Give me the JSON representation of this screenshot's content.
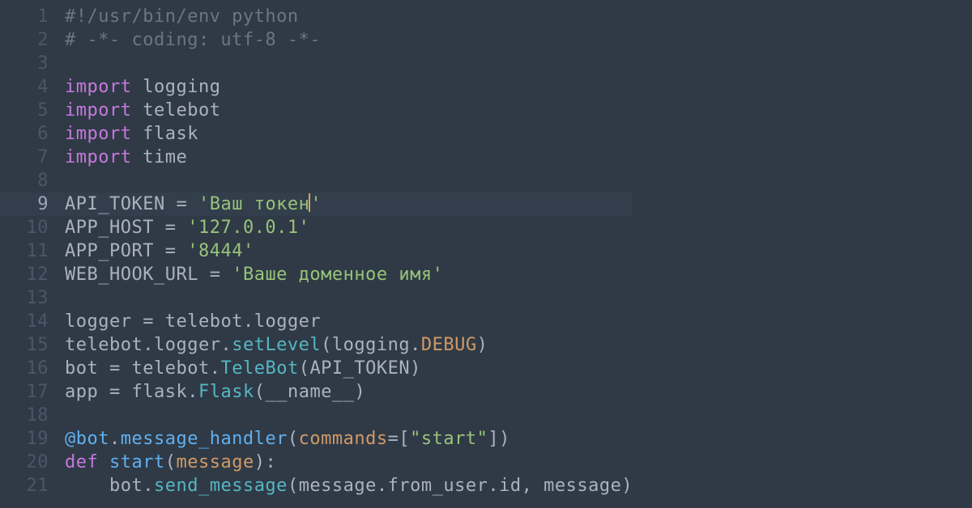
{
  "editor": {
    "language": "python",
    "cursor_line": 9,
    "gutter": [
      "1",
      "2",
      "3",
      "4",
      "5",
      "6",
      "7",
      "8",
      "9",
      "10",
      "11",
      "12",
      "13",
      "14",
      "15",
      "16",
      "17",
      "18",
      "19",
      "20",
      "21"
    ],
    "lines": [
      {
        "n": 1,
        "tokens": [
          [
            "c-comment",
            "#!/usr/bin/env python"
          ]
        ]
      },
      {
        "n": 2,
        "tokens": [
          [
            "c-comment",
            "# -*- coding: utf-8 -*-"
          ]
        ]
      },
      {
        "n": 3,
        "tokens": []
      },
      {
        "n": 4,
        "tokens": [
          [
            "c-kw",
            "import"
          ],
          [
            "space",
            " "
          ],
          [
            "c-mod",
            "logging"
          ]
        ]
      },
      {
        "n": 5,
        "tokens": [
          [
            "c-kw",
            "import"
          ],
          [
            "space",
            " "
          ],
          [
            "c-mod",
            "telebot"
          ]
        ]
      },
      {
        "n": 6,
        "tokens": [
          [
            "c-kw",
            "import"
          ],
          [
            "space",
            " "
          ],
          [
            "c-mod",
            "flask"
          ]
        ]
      },
      {
        "n": 7,
        "tokens": [
          [
            "c-kw",
            "import"
          ],
          [
            "space",
            " "
          ],
          [
            "c-mod",
            "time"
          ]
        ]
      },
      {
        "n": 8,
        "tokens": []
      },
      {
        "n": 9,
        "hl": true,
        "caret_after": 4,
        "tokens": [
          [
            "c-var",
            "API_TOKEN"
          ],
          [
            "space",
            " "
          ],
          [
            "c-op",
            "="
          ],
          [
            "space",
            " "
          ],
          [
            "c-str",
            "'Ваш токен'"
          ]
        ]
      },
      {
        "n": 10,
        "tokens": [
          [
            "c-var",
            "APP_HOST"
          ],
          [
            "space",
            " "
          ],
          [
            "c-op",
            "="
          ],
          [
            "space",
            " "
          ],
          [
            "c-str",
            "'127.0.0.1'"
          ]
        ]
      },
      {
        "n": 11,
        "tokens": [
          [
            "c-var",
            "APP_PORT"
          ],
          [
            "space",
            " "
          ],
          [
            "c-op",
            "="
          ],
          [
            "space",
            " "
          ],
          [
            "c-str",
            "'8444'"
          ]
        ]
      },
      {
        "n": 12,
        "tokens": [
          [
            "c-var",
            "WEB_HOOK_URL"
          ],
          [
            "space",
            " "
          ],
          [
            "c-op",
            "="
          ],
          [
            "space",
            " "
          ],
          [
            "c-str",
            "'Ваше доменное имя'"
          ]
        ]
      },
      {
        "n": 13,
        "tokens": []
      },
      {
        "n": 14,
        "tokens": [
          [
            "c-var",
            "logger"
          ],
          [
            "space",
            " "
          ],
          [
            "c-op",
            "="
          ],
          [
            "space",
            " "
          ],
          [
            "c-var",
            "telebot"
          ],
          [
            "c-punct",
            "."
          ],
          [
            "c-var",
            "logger"
          ]
        ]
      },
      {
        "n": 15,
        "tokens": [
          [
            "c-var",
            "telebot"
          ],
          [
            "c-punct",
            "."
          ],
          [
            "c-var",
            "logger"
          ],
          [
            "c-punct",
            "."
          ],
          [
            "c-func",
            "setLevel"
          ],
          [
            "c-punct",
            "("
          ],
          [
            "c-var",
            "logging"
          ],
          [
            "c-punct",
            "."
          ],
          [
            "c-const",
            "DEBUG"
          ],
          [
            "c-punct",
            ")"
          ]
        ]
      },
      {
        "n": 16,
        "tokens": [
          [
            "c-var",
            "bot"
          ],
          [
            "space",
            " "
          ],
          [
            "c-op",
            "="
          ],
          [
            "space",
            " "
          ],
          [
            "c-var",
            "telebot"
          ],
          [
            "c-punct",
            "."
          ],
          [
            "c-func",
            "TeleBot"
          ],
          [
            "c-punct",
            "("
          ],
          [
            "c-var",
            "API_TOKEN"
          ],
          [
            "c-punct",
            ")"
          ]
        ]
      },
      {
        "n": 17,
        "tokens": [
          [
            "c-var",
            "app"
          ],
          [
            "space",
            " "
          ],
          [
            "c-op",
            "="
          ],
          [
            "space",
            " "
          ],
          [
            "c-var",
            "flask"
          ],
          [
            "c-punct",
            "."
          ],
          [
            "c-func",
            "Flask"
          ],
          [
            "c-punct",
            "("
          ],
          [
            "c-var",
            "__name__"
          ],
          [
            "c-punct",
            ")"
          ]
        ]
      },
      {
        "n": 18,
        "tokens": []
      },
      {
        "n": 19,
        "tokens": [
          [
            "c-func2",
            "@bot"
          ],
          [
            "c-punct",
            "."
          ],
          [
            "c-func2",
            "message_handler"
          ],
          [
            "c-punct",
            "("
          ],
          [
            "c-param",
            "commands"
          ],
          [
            "c-op",
            "="
          ],
          [
            "c-punct",
            "["
          ],
          [
            "c-str",
            "\"start\""
          ],
          [
            "c-punct",
            "]"
          ],
          [
            "c-punct",
            ")"
          ]
        ]
      },
      {
        "n": 20,
        "tokens": [
          [
            "c-kw",
            "def"
          ],
          [
            "space",
            " "
          ],
          [
            "c-func2",
            "start"
          ],
          [
            "c-punct",
            "("
          ],
          [
            "c-param",
            "message"
          ],
          [
            "c-punct",
            ")"
          ],
          [
            "c-punct",
            ":"
          ]
        ]
      },
      {
        "n": 21,
        "tokens": [
          [
            "space",
            "    "
          ],
          [
            "c-var",
            "bot"
          ],
          [
            "c-punct",
            "."
          ],
          [
            "c-func",
            "send_message"
          ],
          [
            "c-punct",
            "("
          ],
          [
            "c-var",
            "message"
          ],
          [
            "c-punct",
            "."
          ],
          [
            "c-var",
            "from_user"
          ],
          [
            "c-punct",
            "."
          ],
          [
            "c-var",
            "id"
          ],
          [
            "c-punct",
            ","
          ],
          [
            "space",
            " "
          ],
          [
            "c-var",
            "message"
          ],
          [
            "c-punct",
            ")"
          ]
        ]
      }
    ]
  }
}
